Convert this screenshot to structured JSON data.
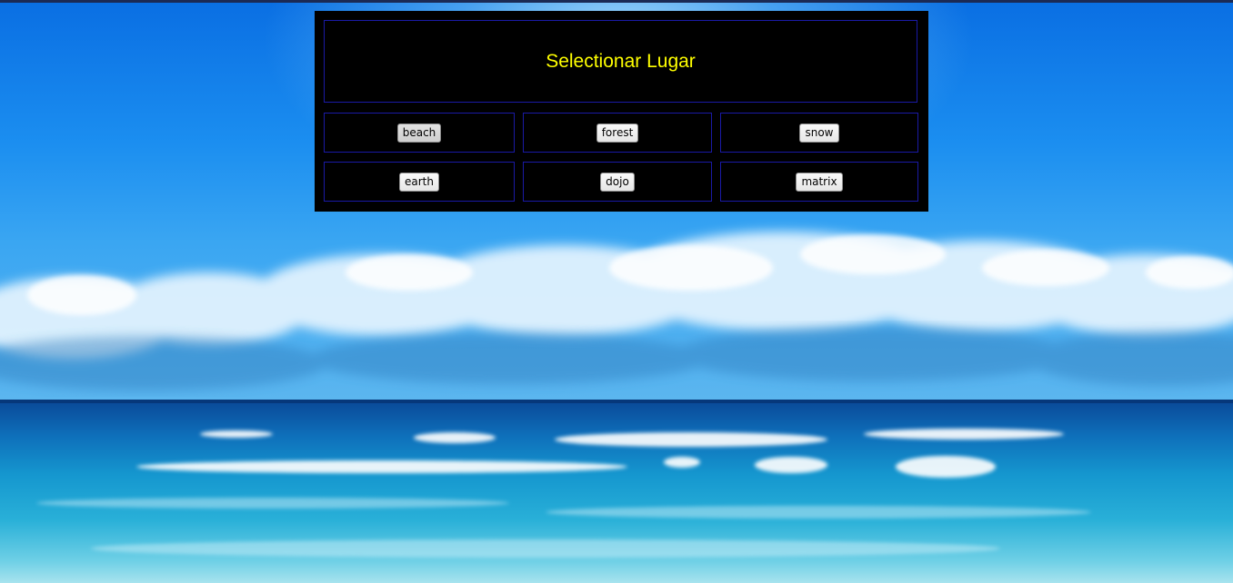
{
  "selector": {
    "title": "Selectionar Lugar",
    "places": [
      {
        "label": "beach",
        "active": true
      },
      {
        "label": "forest",
        "active": false
      },
      {
        "label": "snow",
        "active": false
      },
      {
        "label": "earth",
        "active": false
      },
      {
        "label": "dojo",
        "active": false
      },
      {
        "label": "matrix",
        "active": false
      }
    ]
  },
  "colors": {
    "title_text": "#ffff00",
    "panel_background": "#000000",
    "cell_border": "#1a1aa6"
  }
}
